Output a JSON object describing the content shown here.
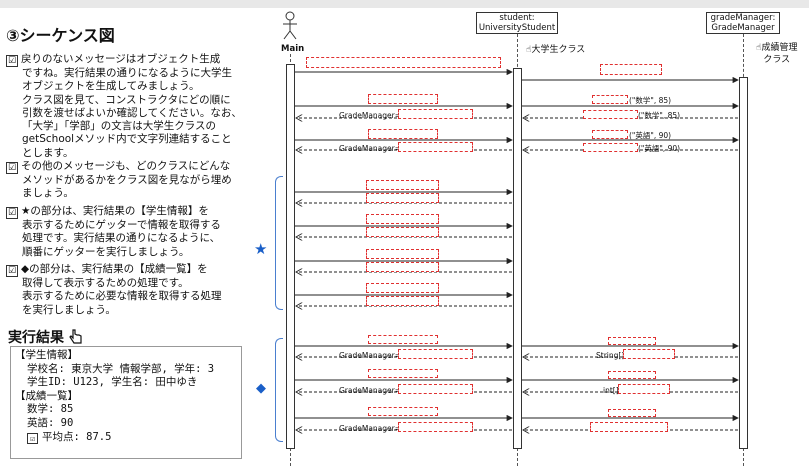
{
  "title": "③シーケンス図",
  "instructions": [
    {
      "lines": [
        "戻りのないメッセージはオブジェクト生成",
        "ですね。実行結果の通りになるように大学生",
        "オブジェクトを生成してみましょう。",
        "クラス図を見て、コンストラクタにどの順に",
        "引数を渡せばよいか確認してください。なお、",
        "「大学」「学部」の文言は大学生クラスの",
        "getSchoolメソッド内で文字列連結すること",
        "とします。"
      ]
    },
    {
      "lines": [
        "その他のメッセージも、どのクラスにどんな",
        "メソッドがあるかをクラス図を見ながら埋め",
        "ましょう。"
      ]
    },
    {
      "lines": [
        "★の部分は、実行結果の【学生情報】を",
        "表示するためにゲッターで情報を取得する",
        "処理です。実行結果の通りになるように、",
        "順番にゲッターを実行しましょう。"
      ]
    },
    {
      "lines": [
        "◆の部分は、実行結果の【成績一覧】を",
        "取得して表示するための処理です。",
        "表示するために必要な情報を取得する処理",
        "を実行しましょう。"
      ]
    }
  ],
  "result": {
    "title": "実行結果",
    "header1": "【学生情報】",
    "school": "学校名: 東京大学 情報学部, 学年: 3",
    "student": "学生ID: U123, 学生名: 田中ゆき",
    "header2": "【成績一覧】",
    "math": "数学: 85",
    "english": "英語: 90",
    "avg": "平均点: 87.5"
  },
  "diagram": {
    "actor": "Main",
    "student_box": [
      "student:",
      "UniversityStudent"
    ],
    "grade_box": [
      "gradeManager:",
      "GradeManager"
    ],
    "note_student": "大学生クラス",
    "note_grade": [
      "成績管理",
      "クラス"
    ],
    "gm_label": "GradeManager=",
    "math_arg": "(\"数学\", 85)",
    "eng_arg": "(\"英語\", 90)",
    "string_arr": "String[]=",
    "int_arr": "int[]=",
    "star": "★",
    "diamond": "◆",
    "check": "☑"
  }
}
